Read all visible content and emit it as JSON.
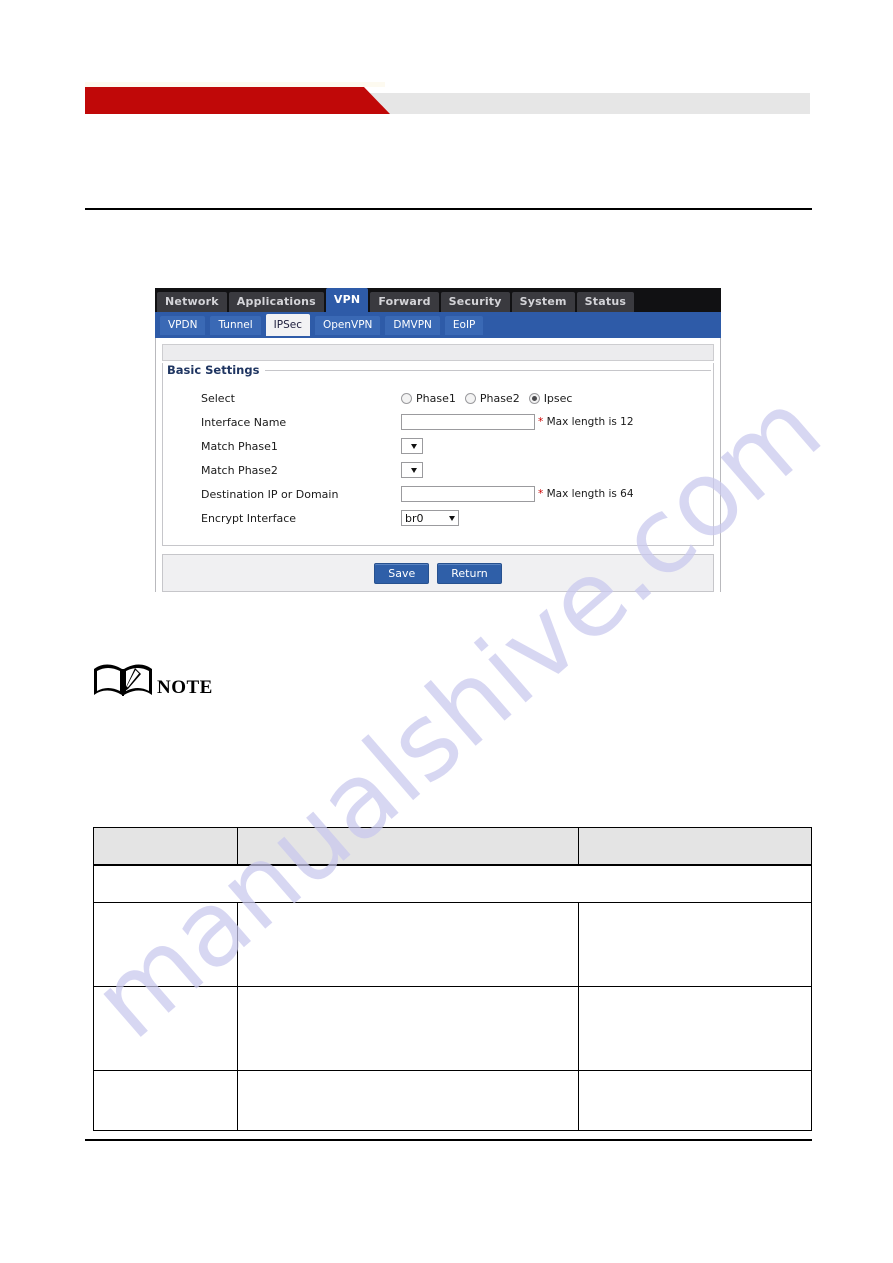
{
  "document": {
    "header_banner": {
      "style": "red-parallelogram-with-grey-bar"
    }
  },
  "router_ui": {
    "main_nav": [
      {
        "label": "Network",
        "active": false
      },
      {
        "label": "Applications",
        "active": false
      },
      {
        "label": "VPN",
        "active": true
      },
      {
        "label": "Forward",
        "active": false
      },
      {
        "label": "Security",
        "active": false
      },
      {
        "label": "System",
        "active": false
      },
      {
        "label": "Status",
        "active": false
      }
    ],
    "sub_nav": [
      {
        "label": "VPDN",
        "active": false
      },
      {
        "label": "Tunnel",
        "active": false
      },
      {
        "label": "IPSec",
        "active": true
      },
      {
        "label": "OpenVPN",
        "active": false
      },
      {
        "label": "DMVPN",
        "active": false
      },
      {
        "label": "EoIP",
        "active": false
      }
    ],
    "panel": {
      "title": "Basic Settings",
      "fields": {
        "select": {
          "label": "Select",
          "options": [
            {
              "label": "Phase1",
              "checked": false
            },
            {
              "label": "Phase2",
              "checked": false
            },
            {
              "label": "Ipsec",
              "checked": true
            }
          ]
        },
        "interface_name": {
          "label": "Interface Name",
          "value": "",
          "hint_star": "*",
          "hint": "Max length is 12"
        },
        "match_phase1": {
          "label": "Match Phase1",
          "value": ""
        },
        "match_phase2": {
          "label": "Match Phase2",
          "value": ""
        },
        "destination": {
          "label": "Destination IP or Domain",
          "value": "",
          "hint_star": "*",
          "hint": "Max length is 64"
        },
        "encrypt_interface": {
          "label": "Encrypt Interface",
          "value": "br0"
        }
      }
    },
    "buttons": {
      "save": "Save",
      "return": "Return"
    },
    "colors": {
      "nav_active": "#2e5ba8",
      "nav_bar": "#111113",
      "subnav": "#2e5ba8",
      "panel_title": "#1f3561",
      "button": "#2f5fa8",
      "required_star": "#cc0000"
    }
  },
  "note": {
    "label": "NOTE",
    "body": ""
  },
  "param_table": {
    "headers": [
      "",
      "",
      ""
    ],
    "span_row": "",
    "rows": [
      {
        "cells": [
          "",
          "",
          ""
        ]
      },
      {
        "cells": [
          "",
          "",
          ""
        ]
      },
      {
        "cells": [
          "",
          "",
          ""
        ]
      }
    ]
  },
  "watermark": {
    "text": "manualshive.com",
    "color": "#c9c8ee"
  }
}
